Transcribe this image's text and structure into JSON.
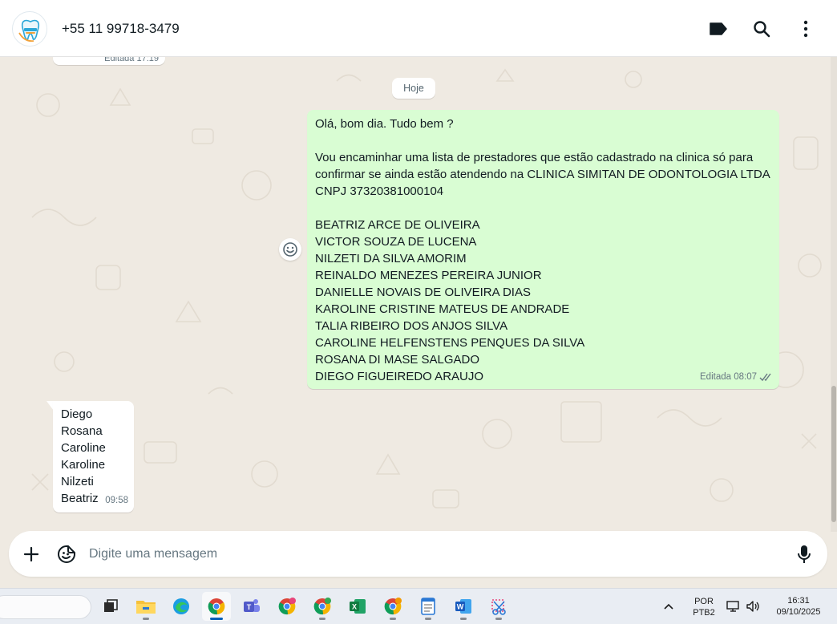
{
  "header": {
    "contact_name": "+55 11 99718-3479",
    "icons": [
      "tag-icon",
      "search-icon",
      "more-vertical-icon"
    ]
  },
  "chat": {
    "prev_message_meta": "Editada 17:19",
    "date_divider": "Hoje",
    "outgoing": {
      "lines": [
        "Olá, bom dia. Tudo bem ?",
        "",
        "Vou encaminhar uma lista de prestadores que estão cadastrado na clinica só para",
        "confirmar se ainda estão atendendo na CLINICA SIMITAN DE ODONTOLOGIA LTDA",
        "CNPJ 37320381000104",
        "",
        "BEATRIZ ARCE DE OLIVEIRA",
        "VICTOR SOUZA DE LUCENA",
        "NILZETI DA SILVA AMORIM",
        "REINALDO MENEZES PEREIRA JUNIOR",
        "DANIELLE NOVAIS DE OLIVEIRA DIAS",
        "KAROLINE CRISTINE MATEUS DE ANDRADE",
        "TALIA RIBEIRO DOS ANJOS SILVA",
        "CAROLINE HELFENSTENS PENQUES DA SILVA",
        "ROSANA DI MASE SALGADO",
        "DIEGO FIGUEIREDO ARAUJO"
      ],
      "meta": "Editada 08:07",
      "status_icon": "double-check-icon"
    },
    "incoming": {
      "lines": [
        "Diego",
        "Rosana",
        "Caroline",
        "Karoline",
        "Nilzeti",
        "Beatriz"
      ],
      "time": "09:58"
    }
  },
  "composer": {
    "placeholder": "Digite uma mensagem",
    "icons": [
      "plus-icon",
      "sticker-icon",
      "microphone-icon"
    ]
  },
  "taskbar": {
    "apps": [
      "file-explorer",
      "edge",
      "chrome",
      "teams",
      "chrome",
      "chrome",
      "excel",
      "chrome",
      "notepad",
      "word",
      "snipping-tool"
    ],
    "language": "POR",
    "keyboard": "PTB2",
    "time": "16:31",
    "date": "09/10/2025"
  },
  "colors": {
    "outgoing_bubble": "#d9fdd3",
    "incoming_bubble": "#ffffff",
    "chat_background": "#efeae2",
    "header_icon": "#111b21",
    "meta_text": "#667781"
  }
}
